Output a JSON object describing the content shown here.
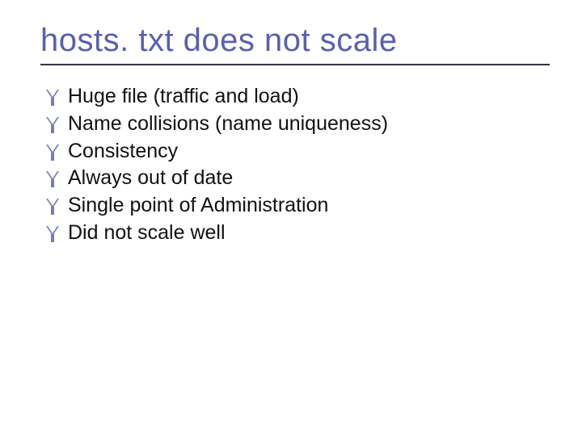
{
  "title": "hosts. txt does not scale",
  "bullets": [
    "Huge file (traffic and load)",
    "Name collisions (name uniqueness)",
    "Consistency",
    "Always out of date",
    "Single point of Administration",
    "Did not scale well"
  ],
  "colors": {
    "title": "#5a5fb3",
    "bullet_icon": "#777db8",
    "text": "#111111",
    "rule": "#333344"
  }
}
